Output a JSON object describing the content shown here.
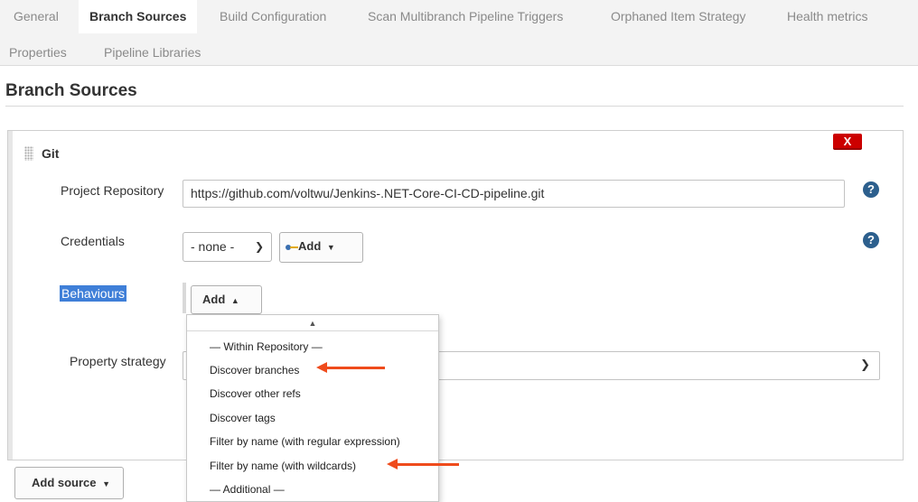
{
  "tabs": {
    "row1": [
      "General",
      "Branch Sources",
      "Build Configuration",
      "Scan Multibranch Pipeline Triggers",
      "Orphaned Item Strategy",
      "Health metrics"
    ],
    "row2": [
      "Properties",
      "Pipeline Libraries"
    ],
    "active": "Branch Sources"
  },
  "section": {
    "title": "Branch Sources"
  },
  "git": {
    "title": "Git",
    "delete_label": "X",
    "project_repository": {
      "label": "Project Repository",
      "value": "https://github.com/voltwu/Jenkins-.NET-Core-CI-CD-pipeline.git"
    },
    "credentials": {
      "label": "Credentials",
      "selected": "- none -",
      "add_label": "Add"
    },
    "behaviours": {
      "label": "Behaviours",
      "add_label": "Add"
    },
    "property_strategy": {
      "label": "Property strategy"
    }
  },
  "add_source_label": "Add source",
  "help_icon_text": "?",
  "behaviours_menu": {
    "items": [
      "— Within Repository —",
      "Discover branches",
      "Discover other refs",
      "Discover tags",
      "Filter by name (with regular expression)",
      "Filter by name (with wildcards)",
      "— Additional —"
    ]
  },
  "colors": {
    "annotation_arrow": "#ef4b1c",
    "delete_button": "#cc0000",
    "help_icon": "#2c5f8d",
    "selection_highlight": "#3f7fd8"
  }
}
